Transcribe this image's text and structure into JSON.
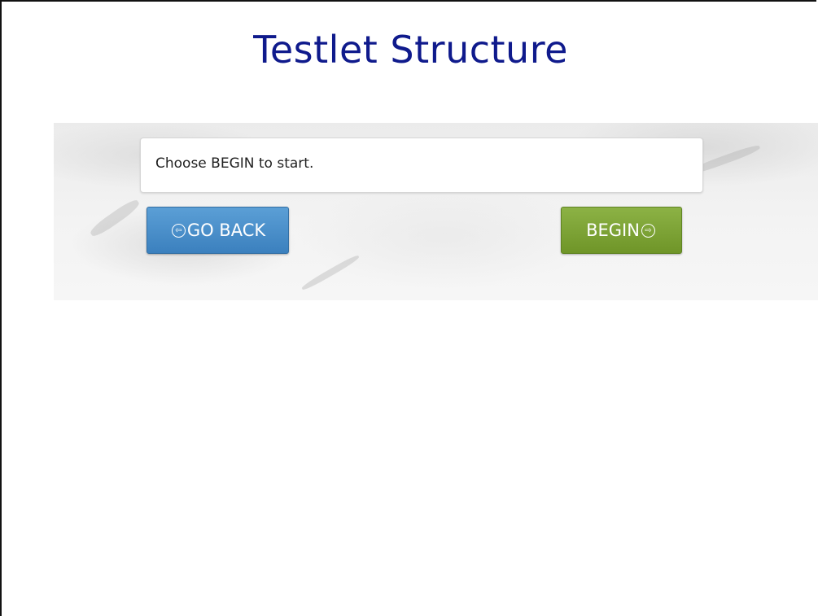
{
  "slide": {
    "title": "Testlet Structure"
  },
  "panel": {
    "message": "Choose BEGIN to start.",
    "back_button": {
      "label": "GO BACK",
      "icon": "arrow-left-circle-icon",
      "color": "#4a90cf"
    },
    "begin_button": {
      "label": "BEGIN",
      "icon": "arrow-right-circle-icon",
      "color": "#7ea437"
    }
  },
  "colors": {
    "title": "#0f1a8c"
  }
}
